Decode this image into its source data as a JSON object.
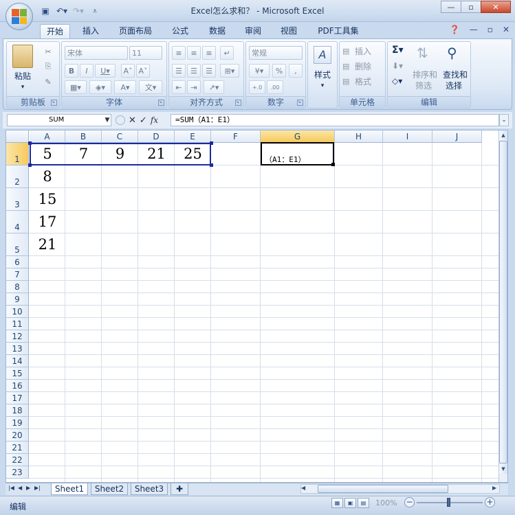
{
  "window": {
    "title": "Excel怎么求和？ - Microsoft Excel"
  },
  "tabs": [
    "开始",
    "插入",
    "页面布局",
    "公式",
    "数据",
    "审阅",
    "视图",
    "PDF工具集"
  ],
  "ribbon": {
    "groups": {
      "clipboard": "剪贴板",
      "font": "字体",
      "alignment": "对齐方式",
      "number": "数字",
      "cells": "单元格",
      "editing": "编辑"
    },
    "paste_label": "粘贴",
    "font_name": "宋体",
    "font_size": "11",
    "number_format": "常规",
    "styles_label": "样式",
    "insert_label": "插入",
    "delete_label": "删除",
    "format_label": "格式",
    "sort_label_1": "排序和",
    "sort_label_2": "筛选",
    "find_label_1": "查找和",
    "find_label_2": "选择",
    "percent": "%",
    "comma": ","
  },
  "formula_bar": {
    "name_box": "SUM",
    "formula": "=SUM（A1：E1）"
  },
  "columns": [
    "A",
    "B",
    "C",
    "D",
    "E",
    "F",
    "G",
    "H",
    "I",
    "J"
  ],
  "rows": [
    "1",
    "2",
    "3",
    "4",
    "5",
    "6",
    "7",
    "8",
    "9",
    "10",
    "11",
    "12",
    "13",
    "14",
    "15",
    "16",
    "17",
    "18",
    "19",
    "20",
    "21",
    "22",
    "23"
  ],
  "cells": {
    "A1": "5",
    "B1": "7",
    "C1": "9",
    "D1": "21",
    "E1": "25",
    "A2": "8",
    "A3": "15",
    "A4": "17",
    "A5": "21",
    "G1": "（A1：E1）"
  },
  "sheet_tabs": [
    "Sheet1",
    "Sheet2",
    "Sheet3"
  ],
  "status": {
    "mode": "编辑",
    "zoom": "100%"
  },
  "colors": {
    "accent": "#1b2a9c",
    "header_selected": "#f7c95d"
  }
}
